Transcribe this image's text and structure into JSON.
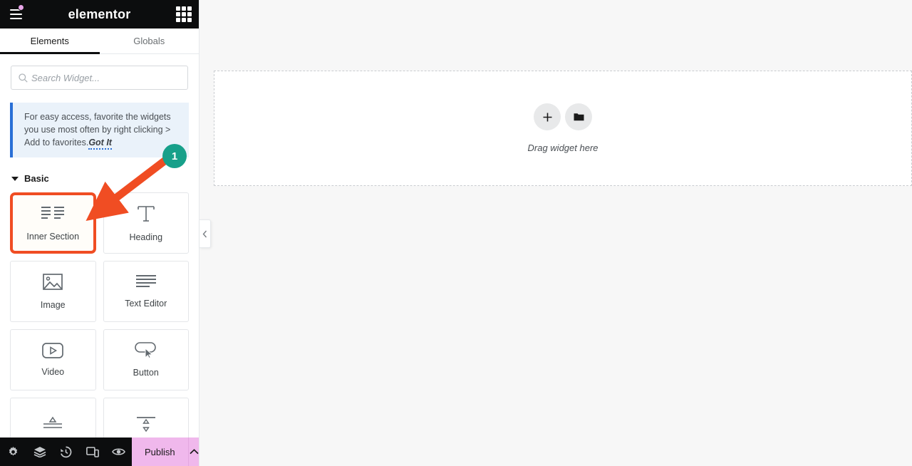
{
  "panel": {
    "header": {
      "brand": "elementor",
      "menu_icon": "hamburger-menu-icon",
      "notification_dot_color": "#e8a5e8",
      "apps_icon": "apps-grid-icon"
    },
    "tabs": [
      {
        "label": "Elements",
        "active": true
      },
      {
        "label": "Globals",
        "active": false
      }
    ],
    "search": {
      "placeholder": "Search Widget...",
      "value": "",
      "icon": "search-icon"
    },
    "notice": {
      "text": "For easy access, favorite the widgets you use most often by right clicking > Add to favorites.",
      "link_label": "Got It",
      "accent_color": "#2a6fd6",
      "background": "#eaf2fa"
    },
    "section": {
      "title": "Basic",
      "expanded": true,
      "caret_icon": "caret-down-icon"
    },
    "widgets": [
      {
        "label": "Inner Section",
        "icon": "inner-section-icon",
        "highlighted": true
      },
      {
        "label": "Heading",
        "icon": "heading-t-icon",
        "highlighted": false
      },
      {
        "label": "Image",
        "icon": "image-icon",
        "highlighted": false
      },
      {
        "label": "Text Editor",
        "icon": "text-editor-icon",
        "highlighted": false
      },
      {
        "label": "Video",
        "icon": "video-play-icon",
        "highlighted": false
      },
      {
        "label": "Button",
        "icon": "button-cursor-icon",
        "highlighted": false
      },
      {
        "label": "",
        "icon": "divider-icon",
        "highlighted": false
      },
      {
        "label": "",
        "icon": "spacer-icon",
        "highlighted": false
      }
    ],
    "collapse_tab": {
      "icon": "chevron-left-icon"
    },
    "bottom_bar": {
      "icons": [
        {
          "name": "settings-gear-icon"
        },
        {
          "name": "layers-navigator-icon"
        },
        {
          "name": "history-clock-icon"
        },
        {
          "name": "responsive-devices-icon"
        },
        {
          "name": "preview-eye-icon"
        }
      ],
      "publish_label": "Publish",
      "publish_color": "#f0b8ec",
      "publish_arrow_icon": "chevron-up-icon"
    }
  },
  "canvas": {
    "dropzone": {
      "label": "Drag widget here",
      "add_icon": "plus-icon",
      "template_icon": "folder-icon"
    }
  },
  "annotation": {
    "badge_number": "1",
    "badge_color": "#17a08a",
    "arrow_color": "#f04d23",
    "highlight_color": "#f04d23"
  }
}
